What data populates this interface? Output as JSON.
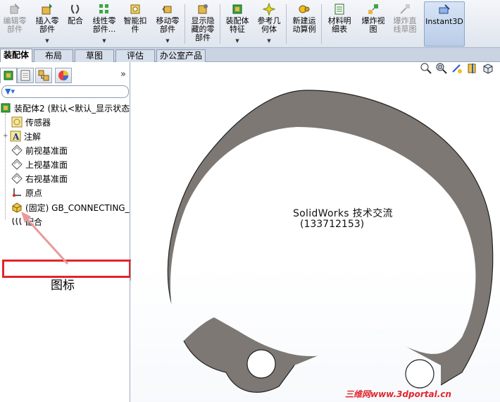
{
  "toolbar": {
    "items": [
      {
        "label": "编辑零\n部件",
        "icon": "edit-part-icon",
        "disabled": true
      },
      {
        "label": "插入零\n部件",
        "icon": "insert-component-icon",
        "dropdown": true
      },
      {
        "label": "配合",
        "icon": "mate-icon"
      },
      {
        "label": "线性零\n部件...",
        "icon": "linear-pattern-icon",
        "dropdown": true
      },
      {
        "label": "智能扣\n件",
        "icon": "smart-fastener-icon"
      },
      {
        "label": "移动零\n部件",
        "icon": "move-component-icon",
        "dropdown": true
      },
      {
        "label": "显示隐\n藏的零\n部件",
        "icon": "show-hidden-icon"
      },
      {
        "label": "装配体\n特征",
        "icon": "assembly-feature-icon",
        "dropdown": true
      },
      {
        "label": "参考几\n何体",
        "icon": "reference-geometry-icon",
        "dropdown": true
      },
      {
        "label": "新建运\n动算例",
        "icon": "motion-study-icon"
      },
      {
        "label": "材料明\n细表",
        "icon": "bom-icon"
      },
      {
        "label": "爆炸视\n图",
        "icon": "exploded-view-icon"
      },
      {
        "label": "爆炸直\n线草图",
        "icon": "explode-line-sketch-icon",
        "disabled": true
      },
      {
        "label": "Instant3D",
        "icon": "instant3d-icon",
        "active": true
      }
    ]
  },
  "tabs": [
    "装配体",
    "布局",
    "草图",
    "评估",
    "办公室产品"
  ],
  "tree": {
    "root": "装配体2 (默认<默认_显示状态",
    "sensors": "传感器",
    "annotations": "注解",
    "front_plane": "前视基准面",
    "top_plane": "上视基准面",
    "right_plane": "右视基准面",
    "origin": "原点",
    "component": "(固定) GB_CONNECTING_",
    "mates": "配合"
  },
  "annotation": {
    "label": "图标"
  },
  "graphics": {
    "watermark_line1": "SolidWorks 技术交流",
    "watermark_line2": "(133712153)",
    "site": "三维网www.3dportal.cn"
  },
  "colors": {
    "part_fill": "#7d7874",
    "highlight": "#e0262c"
  }
}
